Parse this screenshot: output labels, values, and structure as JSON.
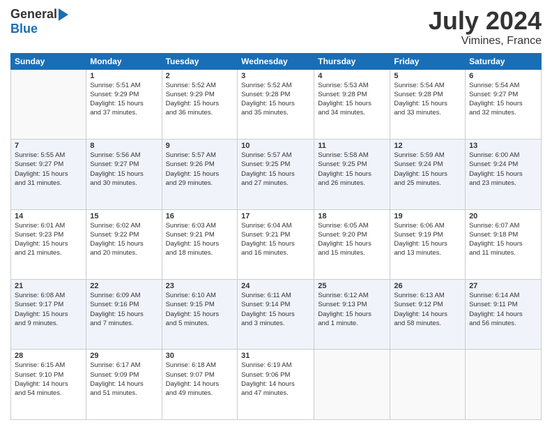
{
  "header": {
    "logo_general": "General",
    "logo_blue": "Blue",
    "month_year": "July 2024",
    "location": "Vimines, France"
  },
  "days_of_week": [
    "Sunday",
    "Monday",
    "Tuesday",
    "Wednesday",
    "Thursday",
    "Friday",
    "Saturday"
  ],
  "weeks": [
    [
      {
        "day": "",
        "sunrise": "",
        "sunset": "",
        "daylight": ""
      },
      {
        "day": "1",
        "sunrise": "Sunrise: 5:51 AM",
        "sunset": "Sunset: 9:29 PM",
        "daylight": "Daylight: 15 hours and 37 minutes."
      },
      {
        "day": "2",
        "sunrise": "Sunrise: 5:52 AM",
        "sunset": "Sunset: 9:29 PM",
        "daylight": "Daylight: 15 hours and 36 minutes."
      },
      {
        "day": "3",
        "sunrise": "Sunrise: 5:52 AM",
        "sunset": "Sunset: 9:28 PM",
        "daylight": "Daylight: 15 hours and 35 minutes."
      },
      {
        "day": "4",
        "sunrise": "Sunrise: 5:53 AM",
        "sunset": "Sunset: 9:28 PM",
        "daylight": "Daylight: 15 hours and 34 minutes."
      },
      {
        "day": "5",
        "sunrise": "Sunrise: 5:54 AM",
        "sunset": "Sunset: 9:28 PM",
        "daylight": "Daylight: 15 hours and 33 minutes."
      },
      {
        "day": "6",
        "sunrise": "Sunrise: 5:54 AM",
        "sunset": "Sunset: 9:27 PM",
        "daylight": "Daylight: 15 hours and 32 minutes."
      }
    ],
    [
      {
        "day": "7",
        "sunrise": "Sunrise: 5:55 AM",
        "sunset": "Sunset: 9:27 PM",
        "daylight": "Daylight: 15 hours and 31 minutes."
      },
      {
        "day": "8",
        "sunrise": "Sunrise: 5:56 AM",
        "sunset": "Sunset: 9:27 PM",
        "daylight": "Daylight: 15 hours and 30 minutes."
      },
      {
        "day": "9",
        "sunrise": "Sunrise: 5:57 AM",
        "sunset": "Sunset: 9:26 PM",
        "daylight": "Daylight: 15 hours and 29 minutes."
      },
      {
        "day": "10",
        "sunrise": "Sunrise: 5:57 AM",
        "sunset": "Sunset: 9:25 PM",
        "daylight": "Daylight: 15 hours and 27 minutes."
      },
      {
        "day": "11",
        "sunrise": "Sunrise: 5:58 AM",
        "sunset": "Sunset: 9:25 PM",
        "daylight": "Daylight: 15 hours and 26 minutes."
      },
      {
        "day": "12",
        "sunrise": "Sunrise: 5:59 AM",
        "sunset": "Sunset: 9:24 PM",
        "daylight": "Daylight: 15 hours and 25 minutes."
      },
      {
        "day": "13",
        "sunrise": "Sunrise: 6:00 AM",
        "sunset": "Sunset: 9:24 PM",
        "daylight": "Daylight: 15 hours and 23 minutes."
      }
    ],
    [
      {
        "day": "14",
        "sunrise": "Sunrise: 6:01 AM",
        "sunset": "Sunset: 9:23 PM",
        "daylight": "Daylight: 15 hours and 21 minutes."
      },
      {
        "day": "15",
        "sunrise": "Sunrise: 6:02 AM",
        "sunset": "Sunset: 9:22 PM",
        "daylight": "Daylight: 15 hours and 20 minutes."
      },
      {
        "day": "16",
        "sunrise": "Sunrise: 6:03 AM",
        "sunset": "Sunset: 9:21 PM",
        "daylight": "Daylight: 15 hours and 18 minutes."
      },
      {
        "day": "17",
        "sunrise": "Sunrise: 6:04 AM",
        "sunset": "Sunset: 9:21 PM",
        "daylight": "Daylight: 15 hours and 16 minutes."
      },
      {
        "day": "18",
        "sunrise": "Sunrise: 6:05 AM",
        "sunset": "Sunset: 9:20 PM",
        "daylight": "Daylight: 15 hours and 15 minutes."
      },
      {
        "day": "19",
        "sunrise": "Sunrise: 6:06 AM",
        "sunset": "Sunset: 9:19 PM",
        "daylight": "Daylight: 15 hours and 13 minutes."
      },
      {
        "day": "20",
        "sunrise": "Sunrise: 6:07 AM",
        "sunset": "Sunset: 9:18 PM",
        "daylight": "Daylight: 15 hours and 11 minutes."
      }
    ],
    [
      {
        "day": "21",
        "sunrise": "Sunrise: 6:08 AM",
        "sunset": "Sunset: 9:17 PM",
        "daylight": "Daylight: 15 hours and 9 minutes."
      },
      {
        "day": "22",
        "sunrise": "Sunrise: 6:09 AM",
        "sunset": "Sunset: 9:16 PM",
        "daylight": "Daylight: 15 hours and 7 minutes."
      },
      {
        "day": "23",
        "sunrise": "Sunrise: 6:10 AM",
        "sunset": "Sunset: 9:15 PM",
        "daylight": "Daylight: 15 hours and 5 minutes."
      },
      {
        "day": "24",
        "sunrise": "Sunrise: 6:11 AM",
        "sunset": "Sunset: 9:14 PM",
        "daylight": "Daylight: 15 hours and 3 minutes."
      },
      {
        "day": "25",
        "sunrise": "Sunrise: 6:12 AM",
        "sunset": "Sunset: 9:13 PM",
        "daylight": "Daylight: 15 hours and 1 minute."
      },
      {
        "day": "26",
        "sunrise": "Sunrise: 6:13 AM",
        "sunset": "Sunset: 9:12 PM",
        "daylight": "Daylight: 14 hours and 58 minutes."
      },
      {
        "day": "27",
        "sunrise": "Sunrise: 6:14 AM",
        "sunset": "Sunset: 9:11 PM",
        "daylight": "Daylight: 14 hours and 56 minutes."
      }
    ],
    [
      {
        "day": "28",
        "sunrise": "Sunrise: 6:15 AM",
        "sunset": "Sunset: 9:10 PM",
        "daylight": "Daylight: 14 hours and 54 minutes."
      },
      {
        "day": "29",
        "sunrise": "Sunrise: 6:17 AM",
        "sunset": "Sunset: 9:09 PM",
        "daylight": "Daylight: 14 hours and 51 minutes."
      },
      {
        "day": "30",
        "sunrise": "Sunrise: 6:18 AM",
        "sunset": "Sunset: 9:07 PM",
        "daylight": "Daylight: 14 hours and 49 minutes."
      },
      {
        "day": "31",
        "sunrise": "Sunrise: 6:19 AM",
        "sunset": "Sunset: 9:06 PM",
        "daylight": "Daylight: 14 hours and 47 minutes."
      },
      {
        "day": "",
        "sunrise": "",
        "sunset": "",
        "daylight": ""
      },
      {
        "day": "",
        "sunrise": "",
        "sunset": "",
        "daylight": ""
      },
      {
        "day": "",
        "sunrise": "",
        "sunset": "",
        "daylight": ""
      }
    ]
  ]
}
